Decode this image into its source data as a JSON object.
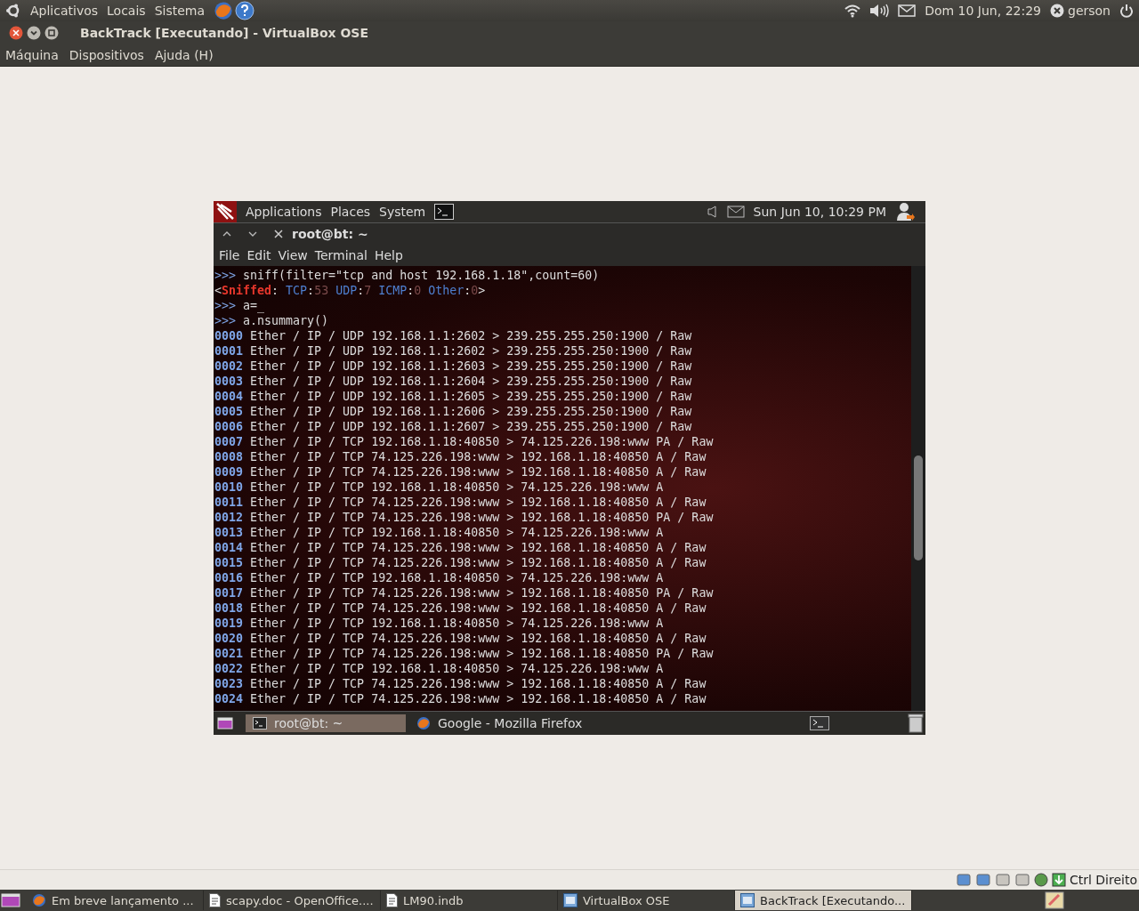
{
  "host_panel": {
    "menus": [
      "Aplicativos",
      "Locais",
      "Sistema"
    ],
    "clock": "Dom 10 Jun, 22:29",
    "user": "gerson"
  },
  "window": {
    "title": "BackTrack [Executando] - VirtualBox OSE",
    "menus": [
      "Máquina",
      "Dispositivos",
      "Ajuda (H)"
    ]
  },
  "guest_panel": {
    "menus": [
      "Applications",
      "Places",
      "System"
    ],
    "clock": "Sun Jun 10, 10:29 PM"
  },
  "terminal": {
    "title": "root@bt: ~",
    "menus": [
      "File",
      "Edit",
      "View",
      "Terminal",
      "Help"
    ],
    "lines": [
      {
        "kind": "prompt",
        "prompt": ">>>",
        "command": "sniff(filter=\"tcp and host 192.168.1.18\",count=60)"
      },
      {
        "kind": "result",
        "segments": [
          {
            "text": "<",
            "kind": "plain"
          },
          {
            "text": "Sniffed",
            "kind": "name"
          },
          {
            "text": ": ",
            "kind": "plain"
          },
          {
            "text": "TCP",
            "kind": "key"
          },
          {
            "text": ":",
            "kind": "plain"
          },
          {
            "text": "53",
            "kind": "num"
          },
          {
            "text": " UDP",
            "kind": "key"
          },
          {
            "text": ":",
            "kind": "plain"
          },
          {
            "text": "7",
            "kind": "num"
          },
          {
            "text": " ICMP",
            "kind": "key"
          },
          {
            "text": ":",
            "kind": "plain"
          },
          {
            "text": "0",
            "kind": "num"
          },
          {
            "text": " Other",
            "kind": "key"
          },
          {
            "text": ":",
            "kind": "plain"
          },
          {
            "text": "0",
            "kind": "num"
          },
          {
            "text": ">",
            "kind": "plain"
          }
        ]
      },
      {
        "kind": "prompt",
        "prompt": ">>>",
        "command": "a=_"
      },
      {
        "kind": "prompt",
        "prompt": ">>>",
        "command": "a.nsummary()"
      },
      {
        "kind": "packet",
        "index": "0000",
        "text": "Ether / IP / UDP 192.168.1.1:2602 > 239.255.255.250:1900 / Raw"
      },
      {
        "kind": "packet",
        "index": "0001",
        "text": "Ether / IP / UDP 192.168.1.1:2602 > 239.255.255.250:1900 / Raw"
      },
      {
        "kind": "packet",
        "index": "0002",
        "text": "Ether / IP / UDP 192.168.1.1:2603 > 239.255.255.250:1900 / Raw"
      },
      {
        "kind": "packet",
        "index": "0003",
        "text": "Ether / IP / UDP 192.168.1.1:2604 > 239.255.255.250:1900 / Raw"
      },
      {
        "kind": "packet",
        "index": "0004",
        "text": "Ether / IP / UDP 192.168.1.1:2605 > 239.255.255.250:1900 / Raw"
      },
      {
        "kind": "packet",
        "index": "0005",
        "text": "Ether / IP / UDP 192.168.1.1:2606 > 239.255.255.250:1900 / Raw"
      },
      {
        "kind": "packet",
        "index": "0006",
        "text": "Ether / IP / UDP 192.168.1.1:2607 > 239.255.255.250:1900 / Raw"
      },
      {
        "kind": "packet",
        "index": "0007",
        "text": "Ether / IP / TCP 192.168.1.18:40850 > 74.125.226.198:www PA / Raw"
      },
      {
        "kind": "packet",
        "index": "0008",
        "text": "Ether / IP / TCP 74.125.226.198:www > 192.168.1.18:40850 A / Raw"
      },
      {
        "kind": "packet",
        "index": "0009",
        "text": "Ether / IP / TCP 74.125.226.198:www > 192.168.1.18:40850 A / Raw"
      },
      {
        "kind": "packet",
        "index": "0010",
        "text": "Ether / IP / TCP 192.168.1.18:40850 > 74.125.226.198:www A"
      },
      {
        "kind": "packet",
        "index": "0011",
        "text": "Ether / IP / TCP 74.125.226.198:www > 192.168.1.18:40850 A / Raw"
      },
      {
        "kind": "packet",
        "index": "0012",
        "text": "Ether / IP / TCP 74.125.226.198:www > 192.168.1.18:40850 PA / Raw"
      },
      {
        "kind": "packet",
        "index": "0013",
        "text": "Ether / IP / TCP 192.168.1.18:40850 > 74.125.226.198:www A"
      },
      {
        "kind": "packet",
        "index": "0014",
        "text": "Ether / IP / TCP 74.125.226.198:www > 192.168.1.18:40850 A / Raw"
      },
      {
        "kind": "packet",
        "index": "0015",
        "text": "Ether / IP / TCP 74.125.226.198:www > 192.168.1.18:40850 A / Raw"
      },
      {
        "kind": "packet",
        "index": "0016",
        "text": "Ether / IP / TCP 192.168.1.18:40850 > 74.125.226.198:www A"
      },
      {
        "kind": "packet",
        "index": "0017",
        "text": "Ether / IP / TCP 74.125.226.198:www > 192.168.1.18:40850 PA / Raw"
      },
      {
        "kind": "packet",
        "index": "0018",
        "text": "Ether / IP / TCP 74.125.226.198:www > 192.168.1.18:40850 A / Raw"
      },
      {
        "kind": "packet",
        "index": "0019",
        "text": "Ether / IP / TCP 192.168.1.18:40850 > 74.125.226.198:www A"
      },
      {
        "kind": "packet",
        "index": "0020",
        "text": "Ether / IP / TCP 74.125.226.198:www > 192.168.1.18:40850 A / Raw"
      },
      {
        "kind": "packet",
        "index": "0021",
        "text": "Ether / IP / TCP 74.125.226.198:www > 192.168.1.18:40850 PA / Raw"
      },
      {
        "kind": "packet",
        "index": "0022",
        "text": "Ether / IP / TCP 192.168.1.18:40850 > 74.125.226.198:www A"
      },
      {
        "kind": "packet",
        "index": "0023",
        "text": "Ether / IP / TCP 74.125.226.198:www > 192.168.1.18:40850 A / Raw"
      },
      {
        "kind": "packet",
        "index": "0024",
        "text": "Ether / IP / TCP 74.125.226.198:www > 192.168.1.18:40850 A / Raw"
      }
    ]
  },
  "guest_taskbar": {
    "tasks": [
      {
        "label": "root@bt: ~",
        "kind": "terminal",
        "selected": true
      },
      {
        "label": "Google - Mozilla Firefox",
        "kind": "browser",
        "selected": false
      }
    ]
  },
  "host_tray": {
    "label": "Ctrl Direito"
  },
  "host_taskbar": {
    "tasks": [
      {
        "label": "Em breve lançamento ...",
        "kind": "browser",
        "selected": false
      },
      {
        "label": "scapy.doc - OpenOffice....",
        "kind": "document",
        "selected": false
      },
      {
        "label": "LM90.indb",
        "kind": "document",
        "selected": false
      },
      {
        "label": "VirtualBox OSE",
        "kind": "window",
        "selected": false
      },
      {
        "label": "BackTrack [Executando...",
        "kind": "window",
        "selected": true
      }
    ]
  }
}
